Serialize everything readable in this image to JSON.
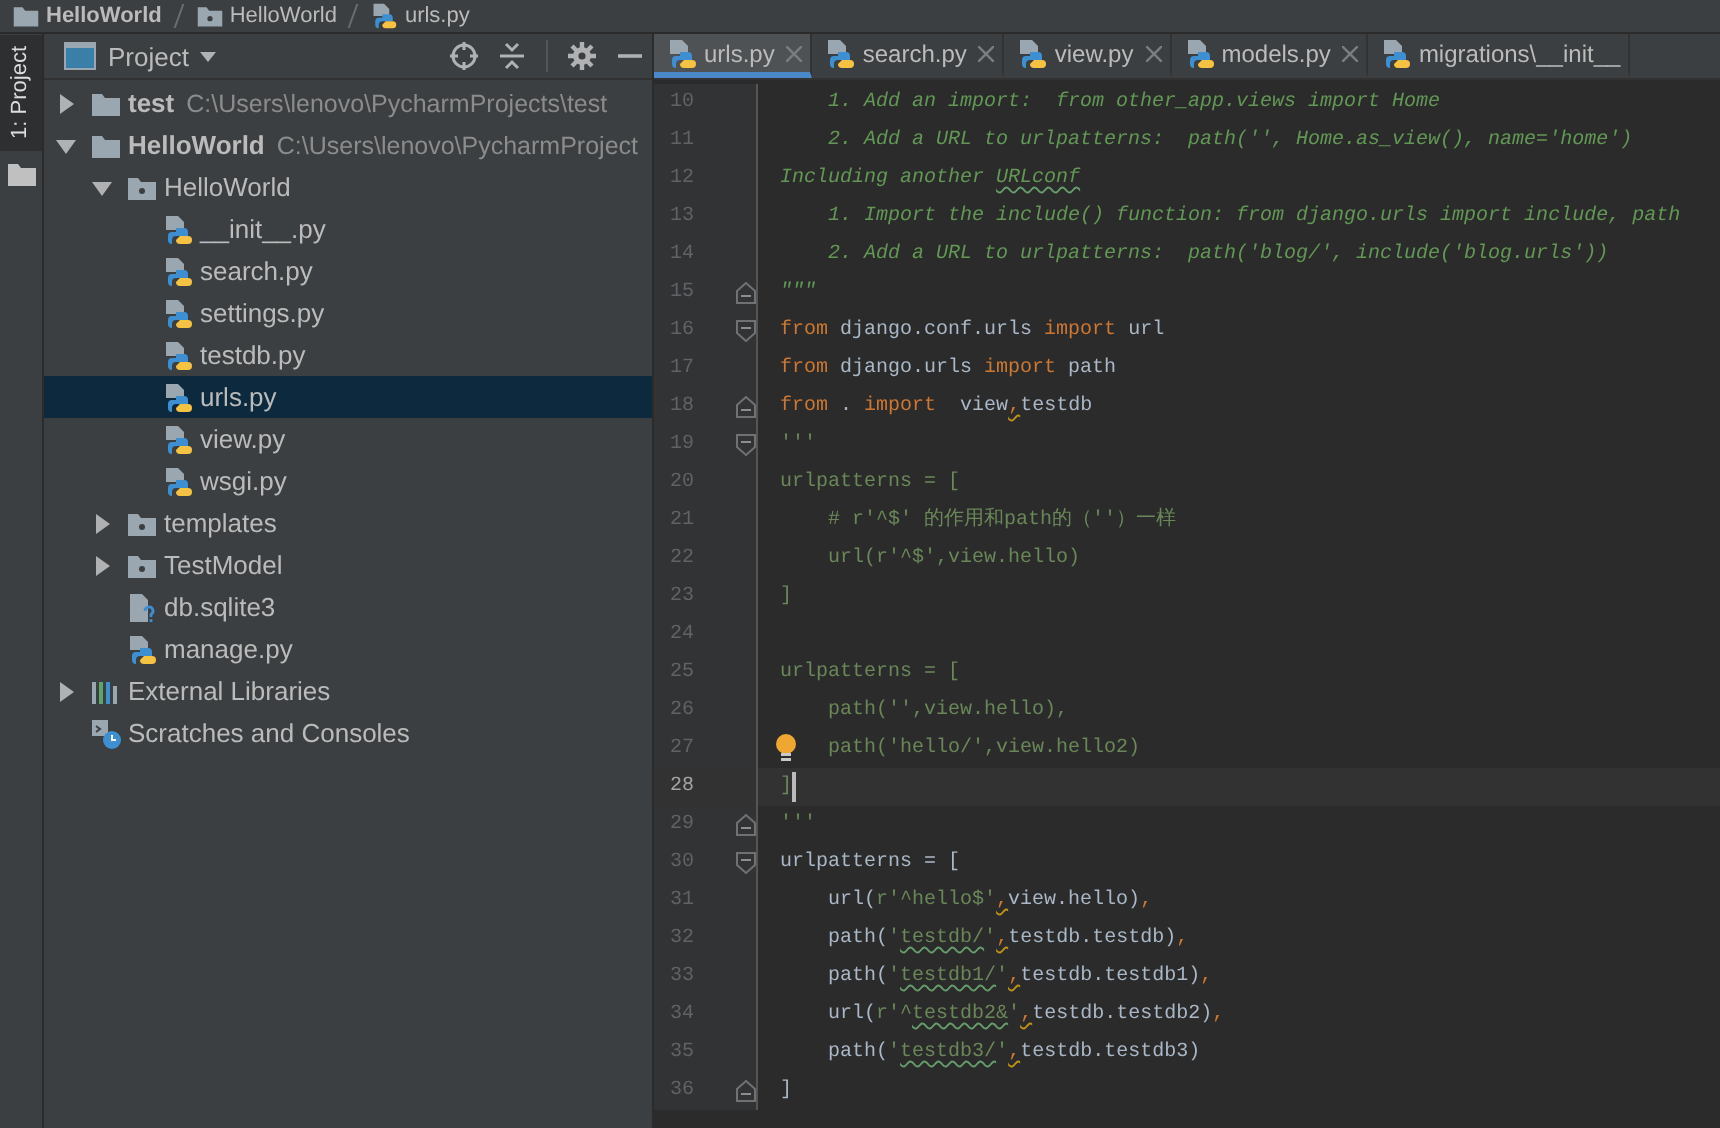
{
  "breadcrumb": [
    {
      "kind": "project",
      "text": "HelloWorld"
    },
    {
      "kind": "package",
      "text": "HelloWorld"
    },
    {
      "kind": "python",
      "text": "urls.py"
    }
  ],
  "side_strip": {
    "tab": "1: Project"
  },
  "project_panel": {
    "title": "Project"
  },
  "tree": [
    {
      "kind": "project",
      "label": "test",
      "path": "C:\\Users\\lenovo\\PycharmProjects\\test",
      "expanded": false,
      "selected": false
    },
    {
      "kind": "project",
      "label": "HelloWorld",
      "path": "C:\\Users\\lenovo\\PycharmProject",
      "expanded": true,
      "selected": false,
      "children": [
        {
          "kind": "package",
          "label": "HelloWorld",
          "expanded": true,
          "selected": false,
          "children": [
            {
              "kind": "python",
              "label": "__init__.py",
              "selected": false
            },
            {
              "kind": "python",
              "label": "search.py",
              "selected": false
            },
            {
              "kind": "python",
              "label": "settings.py",
              "selected": false
            },
            {
              "kind": "python",
              "label": "testdb.py",
              "selected": false
            },
            {
              "kind": "python",
              "label": "urls.py",
              "selected": true
            },
            {
              "kind": "python",
              "label": "view.py",
              "selected": false
            },
            {
              "kind": "python",
              "label": "wsgi.py",
              "selected": false
            }
          ]
        },
        {
          "kind": "package",
          "label": "templates",
          "expanded": false,
          "selected": false
        },
        {
          "kind": "package",
          "label": "TestModel",
          "expanded": false,
          "selected": false
        },
        {
          "kind": "unknown",
          "label": "db.sqlite3",
          "selected": false
        },
        {
          "kind": "python",
          "label": "manage.py",
          "selected": false
        }
      ]
    },
    {
      "kind": "libraries",
      "label": "External Libraries",
      "expanded": false,
      "selected": false
    },
    {
      "kind": "scratches",
      "label": "Scratches and Consoles",
      "selected": false
    }
  ],
  "tabs": [
    {
      "label": "urls.py",
      "selected": true
    },
    {
      "label": "search.py",
      "selected": false
    },
    {
      "label": "view.py",
      "selected": false
    },
    {
      "label": "models.py",
      "selected": false
    },
    {
      "label": "migrations\\__init__",
      "selected": false
    }
  ],
  "code_lines": [
    {
      "number": "10",
      "current": false,
      "bulb": false,
      "tokens": [
        {
          "kind": "doc",
          "text": "    1. Add an import:  from other_app.views import Home"
        }
      ]
    },
    {
      "number": "11",
      "current": false,
      "bulb": false,
      "tokens": [
        {
          "kind": "doc",
          "text": "    2. Add a URL to urlpatterns:  path('', Home.as_view(), name='home')"
        }
      ]
    },
    {
      "number": "12",
      "current": false,
      "bulb": false,
      "tokens": [
        {
          "kind": "doc",
          "text": "Including another "
        },
        {
          "kind": "doc",
          "text": "URLconf",
          "typo": true
        }
      ]
    },
    {
      "number": "13",
      "current": false,
      "bulb": false,
      "tokens": [
        {
          "kind": "doc",
          "text": "    1. Import the include() function: from django.urls import include, path"
        }
      ]
    },
    {
      "number": "14",
      "current": false,
      "bulb": false,
      "tokens": [
        {
          "kind": "doc",
          "text": "    2. Add a URL to urlpatterns:  path('blog/', include('blog.urls'))"
        }
      ]
    },
    {
      "number": "15",
      "current": false,
      "bulb": false,
      "fold_close": true,
      "tokens": [
        {
          "kind": "doc",
          "text": "\"\"\""
        }
      ]
    },
    {
      "number": "16",
      "current": false,
      "bulb": false,
      "fold_open": true,
      "tokens": [
        {
          "kind": "keyword",
          "text": "from"
        },
        {
          "kind": "plain",
          "text": " django.conf.urls "
        },
        {
          "kind": "keyword",
          "text": "import"
        },
        {
          "kind": "plain",
          "text": " url"
        }
      ]
    },
    {
      "number": "17",
      "current": false,
      "bulb": false,
      "tokens": [
        {
          "kind": "keyword",
          "text": "from"
        },
        {
          "kind": "plain",
          "text": " django.urls "
        },
        {
          "kind": "keyword",
          "text": "import"
        },
        {
          "kind": "plain",
          "text": " path"
        }
      ]
    },
    {
      "number": "18",
      "current": false,
      "bulb": false,
      "fold_close": true,
      "tokens": [
        {
          "kind": "keyword",
          "text": "from"
        },
        {
          "kind": "plain",
          "text": " . "
        },
        {
          "kind": "keyword",
          "text": "import"
        },
        {
          "kind": "plain",
          "text": "  view"
        },
        {
          "kind": "keyword",
          "text": ",",
          "warning": true
        },
        {
          "kind": "plain",
          "text": "testdb"
        }
      ]
    },
    {
      "number": "19",
      "current": false,
      "bulb": false,
      "fold_open": true,
      "tokens": [
        {
          "kind": "string",
          "text": "'''"
        }
      ]
    },
    {
      "number": "20",
      "current": false,
      "bulb": false,
      "tokens": [
        {
          "kind": "string",
          "text": "urlpatterns = ["
        }
      ]
    },
    {
      "number": "21",
      "current": false,
      "bulb": false,
      "tokens": [
        {
          "kind": "string",
          "text": "    # r'^$' 的作用和path的（''）一样"
        }
      ]
    },
    {
      "number": "22",
      "current": false,
      "bulb": false,
      "tokens": [
        {
          "kind": "string",
          "text": "    url(r'^$',view.hello)"
        }
      ]
    },
    {
      "number": "23",
      "current": false,
      "bulb": false,
      "tokens": [
        {
          "kind": "string",
          "text": "]"
        }
      ]
    },
    {
      "number": "24",
      "current": false,
      "bulb": false
    },
    {
      "number": "25",
      "current": false,
      "bulb": false,
      "tokens": [
        {
          "kind": "string",
          "text": "urlpatterns = ["
        }
      ]
    },
    {
      "number": "26",
      "current": false,
      "bulb": false,
      "tokens": [
        {
          "kind": "string",
          "text": "    path('',view.hello),"
        }
      ]
    },
    {
      "number": "27",
      "current": false,
      "bulb": true,
      "tokens": [
        {
          "kind": "string",
          "text": "    path('hello/',view.hello2)"
        }
      ]
    },
    {
      "number": "28",
      "current": true,
      "bulb": false,
      "tokens": [
        {
          "kind": "string",
          "text": "]"
        }
      ]
    },
    {
      "number": "29",
      "current": false,
      "bulb": false,
      "fold_close": true,
      "tokens": [
        {
          "kind": "string",
          "text": "'''"
        }
      ]
    },
    {
      "number": "30",
      "current": false,
      "bulb": false,
      "fold_open": true,
      "tokens": [
        {
          "kind": "plain",
          "text": "urlpatterns = ["
        }
      ]
    },
    {
      "number": "31",
      "current": false,
      "bulb": false,
      "tokens": [
        {
          "kind": "plain",
          "text": "    url("
        },
        {
          "kind": "string",
          "text": "r'^hello$'"
        },
        {
          "kind": "keyword",
          "text": ",",
          "warning": true
        },
        {
          "kind": "plain",
          "text": "view.hello)"
        },
        {
          "kind": "keyword",
          "text": ","
        }
      ]
    },
    {
      "number": "32",
      "current": false,
      "bulb": false,
      "tokens": [
        {
          "kind": "plain",
          "text": "    path("
        },
        {
          "kind": "string",
          "text": "'"
        },
        {
          "kind": "string",
          "text": "testdb/",
          "typo": true
        },
        {
          "kind": "string",
          "text": "'"
        },
        {
          "kind": "keyword",
          "text": ",",
          "warning": true
        },
        {
          "kind": "plain",
          "text": "testdb.testdb)"
        },
        {
          "kind": "keyword",
          "text": ","
        }
      ]
    },
    {
      "number": "33",
      "current": false,
      "bulb": false,
      "tokens": [
        {
          "kind": "plain",
          "text": "    path("
        },
        {
          "kind": "string",
          "text": "'"
        },
        {
          "kind": "string",
          "text": "testdb1/",
          "typo": true
        },
        {
          "kind": "string",
          "text": "'"
        },
        {
          "kind": "keyword",
          "text": ",",
          "warning": true
        },
        {
          "kind": "plain",
          "text": "testdb.testdb1)"
        },
        {
          "kind": "keyword",
          "text": ","
        }
      ]
    },
    {
      "number": "34",
      "current": false,
      "bulb": false,
      "tokens": [
        {
          "kind": "plain",
          "text": "    url("
        },
        {
          "kind": "string",
          "text": "r'^"
        },
        {
          "kind": "string",
          "text": "testdb2&",
          "typo": true
        },
        {
          "kind": "string",
          "text": "'"
        },
        {
          "kind": "keyword",
          "text": ",",
          "warning": true
        },
        {
          "kind": "plain",
          "text": "testdb.testdb2)"
        },
        {
          "kind": "keyword",
          "text": ","
        }
      ]
    },
    {
      "number": "35",
      "current": false,
      "bulb": false,
      "tokens": [
        {
          "kind": "plain",
          "text": "    path("
        },
        {
          "kind": "string",
          "text": "'"
        },
        {
          "kind": "string",
          "text": "testdb3/",
          "typo": true
        },
        {
          "kind": "string",
          "text": "'"
        },
        {
          "kind": "keyword",
          "text": ",",
          "warning": true
        },
        {
          "kind": "plain",
          "text": "testdb.testdb3)"
        }
      ]
    },
    {
      "number": "36",
      "current": false,
      "bulb": false,
      "fold_close": true,
      "tokens": [
        {
          "kind": "plain",
          "text": "]"
        }
      ]
    }
  ]
}
